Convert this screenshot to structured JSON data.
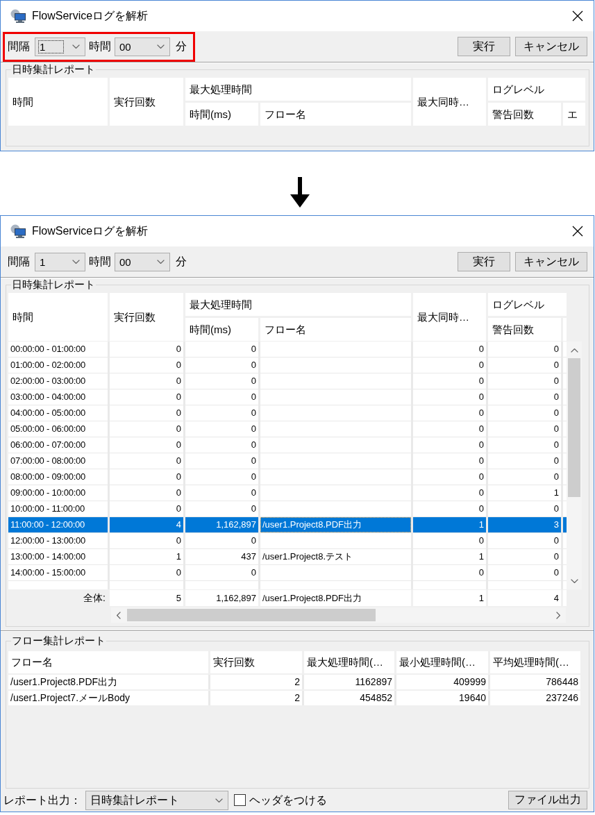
{
  "windows": [
    {
      "title": "FlowServiceログを解析",
      "toolbar": {
        "highlighted": true,
        "interval": {
          "label": "間隔",
          "value": "1",
          "focused": true
        },
        "hour": {
          "label": "時間",
          "value": "00",
          "focused": false
        },
        "unit": "分",
        "buttons": [
          {
            "kind": "run",
            "label": "実行"
          },
          {
            "kind": "cancel",
            "label": "キャンセル"
          }
        ]
      },
      "datetime_report": {
        "title": "日時集計レポート",
        "columns": [
          {
            "label": "時間"
          },
          {
            "label": "実行回数"
          },
          {
            "label": "最大処理時間",
            "children": [
              {
                "label": "時間(ms)"
              },
              {
                "label": "フロー名"
              }
            ]
          },
          {
            "label": "最大同時…"
          },
          {
            "label": "ログレベル",
            "children": [
              {
                "label": "警告回数"
              },
              {
                "label": "エ"
              }
            ]
          }
        ]
      }
    },
    {
      "title": "FlowServiceログを解析",
      "toolbar": {
        "interval": {
          "label": "間隔",
          "value": "1",
          "focused": false
        },
        "hour": {
          "label": "時間",
          "value": "00",
          "focused": false
        },
        "unit": "分",
        "buttons": [
          {
            "kind": "run",
            "label": "実行"
          },
          {
            "kind": "cancel",
            "label": "キャンセル"
          }
        ]
      },
      "datetime_report": {
        "title": "日時集計レポート",
        "columns": [
          {
            "label": "時間"
          },
          {
            "label": "実行回数"
          },
          {
            "label": "最大処理時間",
            "children": [
              {
                "label": "時間(ms)"
              },
              {
                "label": "フロー名"
              }
            ]
          },
          {
            "label": "最大同時…"
          },
          {
            "label": "ログレベル",
            "children": [
              {
                "label": "警告回数"
              }
            ]
          }
        ],
        "rows": [
          {
            "time": "00:00:00 - 01:00:00",
            "runs": "0",
            "max_ms": "0",
            "max_concurrent": "0",
            "warnings": "0",
            "selected": false,
            "focused": false
          },
          {
            "time": "01:00:00 - 02:00:00",
            "runs": "0",
            "max_ms": "0",
            "max_concurrent": "0",
            "warnings": "0",
            "selected": false,
            "focused": false
          },
          {
            "time": "02:00:00 - 03:00:00",
            "runs": "0",
            "max_ms": "0",
            "max_concurrent": "0",
            "warnings": "0",
            "selected": false,
            "focused": false
          },
          {
            "time": "03:00:00 - 04:00:00",
            "runs": "0",
            "max_ms": "0",
            "max_concurrent": "0",
            "warnings": "0",
            "selected": false,
            "focused": false
          },
          {
            "time": "04:00:00 - 05:00:00",
            "runs": "0",
            "max_ms": "0",
            "max_concurrent": "0",
            "warnings": "0",
            "selected": false,
            "focused": false
          },
          {
            "time": "05:00:00 - 06:00:00",
            "runs": "0",
            "max_ms": "0",
            "max_concurrent": "0",
            "warnings": "0",
            "selected": false,
            "focused": false
          },
          {
            "time": "06:00:00 - 07:00:00",
            "runs": "0",
            "max_ms": "0",
            "max_concurrent": "0",
            "warnings": "0",
            "selected": false,
            "focused": false
          },
          {
            "time": "07:00:00 - 08:00:00",
            "runs": "0",
            "max_ms": "0",
            "max_concurrent": "0",
            "warnings": "0",
            "selected": false,
            "focused": false
          },
          {
            "time": "08:00:00 - 09:00:00",
            "runs": "0",
            "max_ms": "0",
            "max_concurrent": "0",
            "warnings": "0",
            "selected": false,
            "focused": false
          },
          {
            "time": "09:00:00 - 10:00:00",
            "runs": "0",
            "max_ms": "0",
            "max_concurrent": "0",
            "warnings": "1",
            "selected": false,
            "focused": false
          },
          {
            "time": "10:00:00 - 11:00:00",
            "runs": "0",
            "max_ms": "0",
            "max_concurrent": "0",
            "warnings": "0",
            "selected": false,
            "focused": false
          },
          {
            "time": "11:00:00 - 12:00:00",
            "runs": "4",
            "max_ms": "1,162,897",
            "flow": "/user1.Project8.PDF出力",
            "max_concurrent": "1",
            "warnings": "3",
            "selected": true,
            "focused": true
          },
          {
            "time": "12:00:00 - 13:00:00",
            "runs": "0",
            "max_ms": "0",
            "max_concurrent": "0",
            "warnings": "0",
            "selected": false,
            "focused": false
          },
          {
            "time": "13:00:00 - 14:00:00",
            "runs": "1",
            "max_ms": "437",
            "flow": "/user1.Project8.テスト",
            "max_concurrent": "1",
            "warnings": "0",
            "selected": false,
            "focused": false
          },
          {
            "time": "14:00:00 - 15:00:00",
            "runs": "0",
            "max_ms": "0",
            "max_concurrent": "0",
            "warnings": "0",
            "selected": false,
            "focused": false
          },
          {
            "selected": false,
            "focused": false
          }
        ],
        "summary": {
          "label": "全体:",
          "runs": "5",
          "max_ms": "1,162,897",
          "flow": "/user1.Project8.PDF出力",
          "max_concurrent": "1",
          "warnings": "4"
        }
      },
      "flow_report": {
        "title": "フロー集計レポート",
        "columns": [
          "フロー名",
          "実行回数",
          "最大処理時間(…",
          "最小処理時間(…",
          "平均処理時間(…"
        ],
        "rows": [
          {
            "cells": [
              "/user1.Project8.PDF出力",
              "2",
              "1162897",
              "409999",
              "786448"
            ],
            "selected": false
          },
          {
            "cells": [
              "/user1.Project7.メールBody",
              "2",
              "454852",
              "19640",
              "237246"
            ],
            "selected": false
          }
        ]
      },
      "footer": {
        "label": "レポート出力：",
        "select": {
          "value": "日時集計レポート"
        },
        "checkbox": {
          "label": "ヘッダをつける",
          "checked": false
        },
        "button": "ファイル出力"
      }
    }
  ]
}
